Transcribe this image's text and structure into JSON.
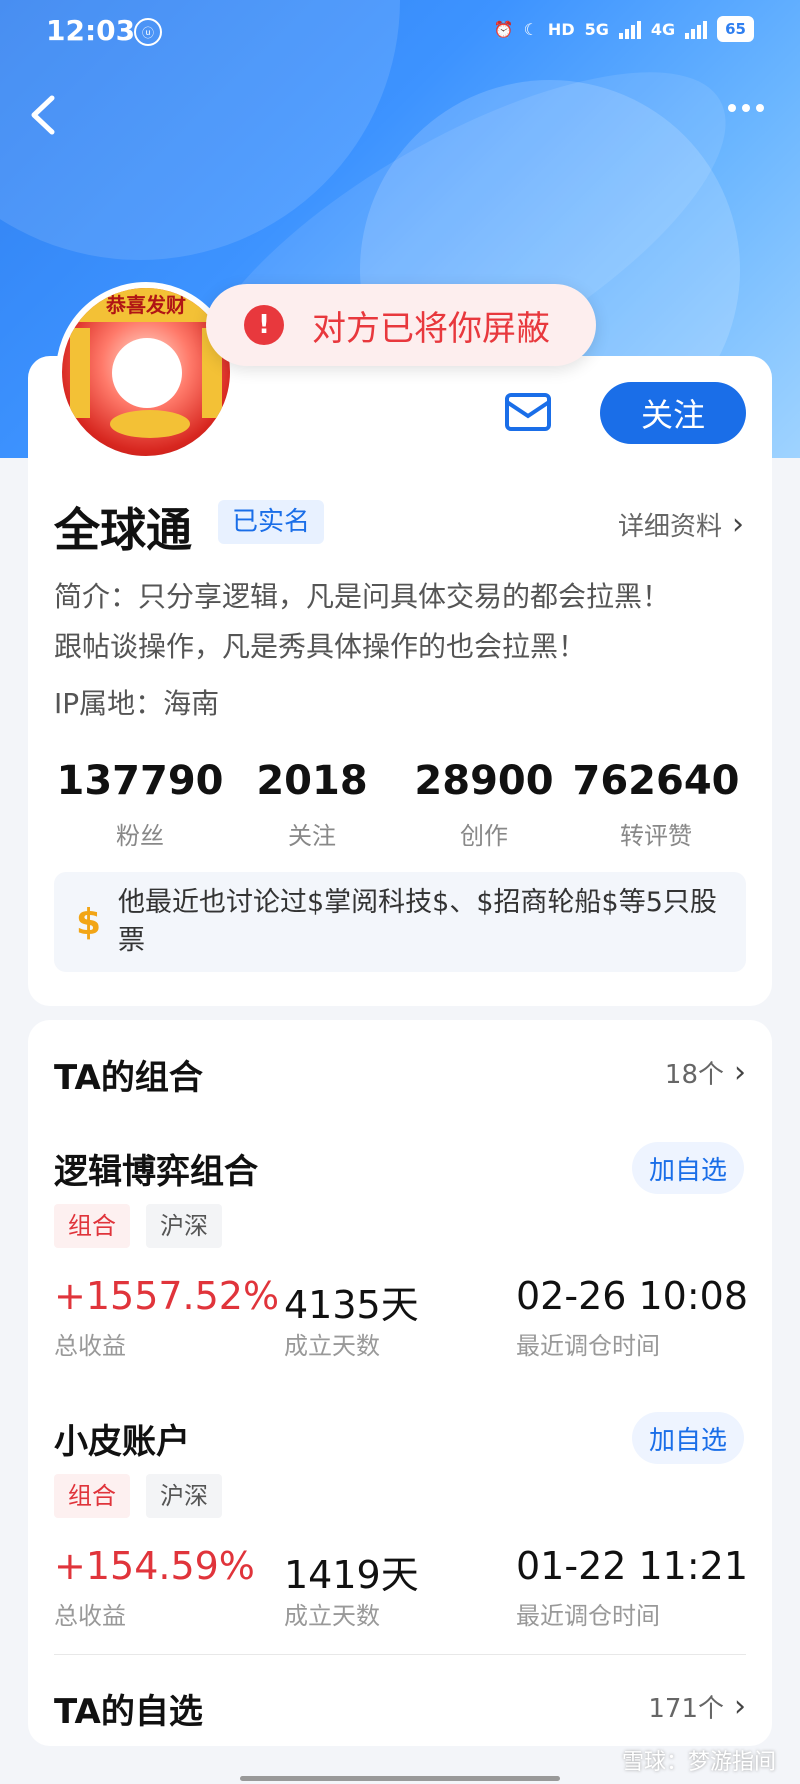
{
  "status": {
    "time": "12:03",
    "indicator": "ⓤ",
    "net_hd": "HD",
    "net_5g": "5G",
    "net_4g": "4G",
    "battery": "65"
  },
  "toast": {
    "text": "对方已将你屏蔽",
    "icon": "exclamation-icon"
  },
  "header": {
    "back_icon": "back-arrow-icon",
    "more_icon": "more-dots-icon"
  },
  "avatar": {
    "banner_text": "恭喜发财"
  },
  "profile": {
    "follow_label": "关注",
    "name": "全球通",
    "verified_label": "已实名",
    "detail_label": "详细资料",
    "bio_line1": "简介：只分享逻辑，凡是问具体交易的都会拉黑！",
    "bio_line2": "跟帖谈操作，凡是秀具体操作的也会拉黑！",
    "ip": "IP属地：海南",
    "stats": [
      {
        "value": "137790",
        "label": "粉丝"
      },
      {
        "value": "2018",
        "label": "关注"
      },
      {
        "value": "28900",
        "label": "创作"
      },
      {
        "value": "762640",
        "label": "转评赞"
      }
    ],
    "mention": "他最近也讨论过$掌阅科技$、$招商轮船$等5只股票"
  },
  "portfolios": {
    "title": "TA的组合",
    "count": "18个",
    "items": [
      {
        "name": "逻辑博弈组合",
        "add_label": "加自选",
        "tag1": "组合",
        "tag2": "沪深",
        "return": "+1557.52%",
        "return_label": "总收益",
        "days": "4135天",
        "days_label": "成立天数",
        "last": "02-26 10:08",
        "last_label": "最近调仓时间"
      },
      {
        "name": "小皮账户",
        "add_label": "加自选",
        "tag1": "组合",
        "tag2": "沪深",
        "return": "+154.59%",
        "return_label": "总收益",
        "days": "1419天",
        "days_label": "成立天数",
        "last": "01-22 11:21",
        "last_label": "最近调仓时间"
      }
    ]
  },
  "watchlist": {
    "title": "TA的自选",
    "count": "171个"
  },
  "watermark": "雪球：梦游指间",
  "colors": {
    "accent": "#1a6ee8",
    "up_red": "#e0343b",
    "warn": "#e8383d"
  }
}
